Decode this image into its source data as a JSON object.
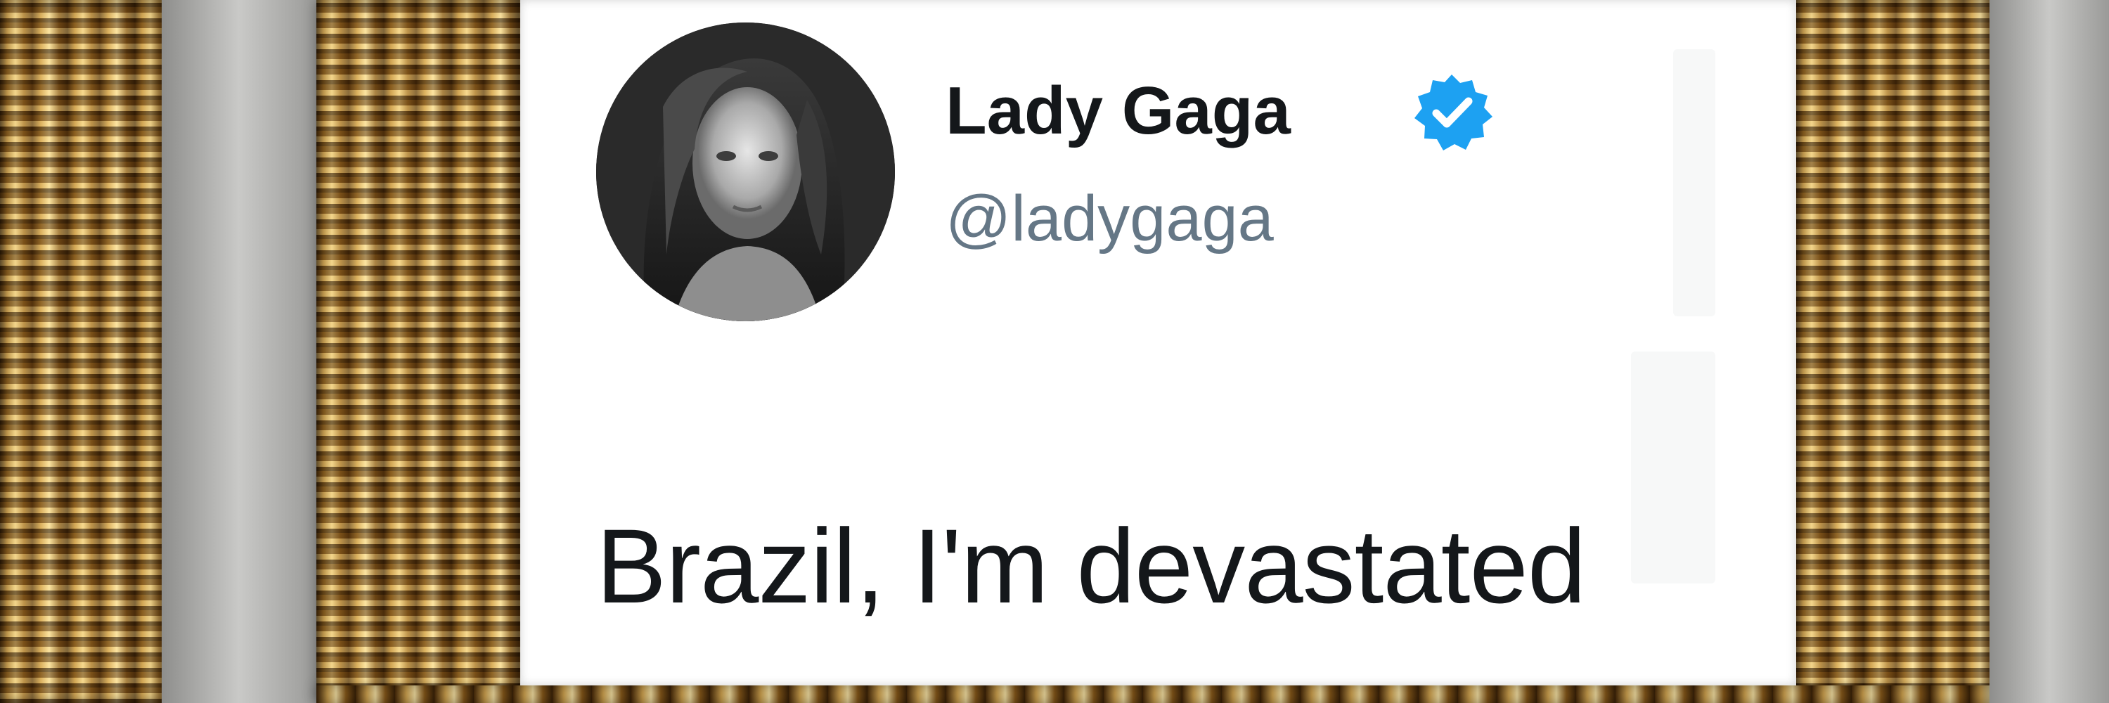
{
  "tweet": {
    "display_name": "Lady Gaga",
    "handle": "@ladygaga",
    "text": "Brazil, I'm devastated",
    "verified": true
  },
  "icons": {
    "avatar": "profile-photo",
    "badge": "verified-badge-icon"
  },
  "colors": {
    "verified_blue": "#1da1f2",
    "name_text": "#14171a",
    "handle_text": "#657786",
    "frame_gold": "#c89640",
    "wall_gray": "#c7c7c5"
  }
}
